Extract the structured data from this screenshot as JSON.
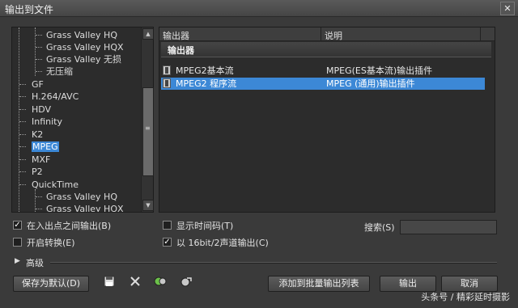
{
  "window": {
    "title": "输出到文件",
    "close_glyph": "✕"
  },
  "tree": {
    "items": [
      {
        "label": "Grass Valley HQ"
      },
      {
        "label": "Grass Valley HQX"
      },
      {
        "label": "Grass Valley 无损"
      },
      {
        "label": "无压缩"
      },
      {
        "label": "GF"
      },
      {
        "label": "H.264/AVC"
      },
      {
        "label": "HDV"
      },
      {
        "label": "Infinity"
      },
      {
        "label": "K2"
      },
      {
        "label": "MPEG",
        "selected": true
      },
      {
        "label": "MXF"
      },
      {
        "label": "P2"
      },
      {
        "label": "QuickTime"
      },
      {
        "label": "Grass Valley HQ"
      },
      {
        "label": "Grass Valley HQX"
      }
    ]
  },
  "list": {
    "columns": {
      "name": "输出器",
      "desc": "说明"
    },
    "group": "输出器",
    "rows": [
      {
        "name": "MPEG2基本流",
        "desc": "MPEG(ES基本流)输出插件",
        "selected": false
      },
      {
        "name": "MPEG2 程序流",
        "desc": "MPEG (通用)输出插件",
        "selected": true
      }
    ]
  },
  "options": {
    "in_out_label": "在入出点之间输出(B)",
    "in_out_checked": true,
    "convert_label": "开启转换(E)",
    "convert_checked": false,
    "timecode_label": "显示时间码(T)",
    "timecode_checked": false,
    "audio_label": "以 16bit/2声道输出(C)",
    "audio_checked": true
  },
  "search": {
    "label": "搜索(S)",
    "value": ""
  },
  "advanced": {
    "label": "高级"
  },
  "buttons": {
    "save_default": "保存为默认(D)",
    "add_batch": "添加到批量输出列表",
    "output": "输出",
    "cancel": "取消"
  },
  "toolbar_icons": [
    "save-icon",
    "delete-icon",
    "preset-icon",
    "export-preset-icon"
  ],
  "watermark": "头条号 / 精彩延时摄影"
}
